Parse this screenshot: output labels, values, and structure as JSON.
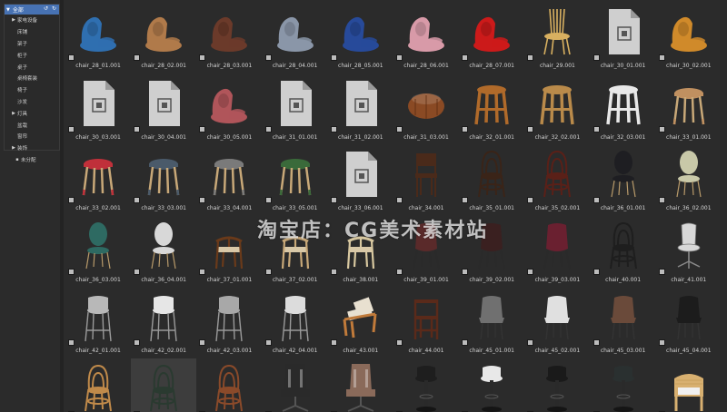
{
  "sidebar": {
    "root_label": "全部",
    "root_controls": "↺ ↻",
    "items": [
      {
        "label": "家电设备",
        "level": 1,
        "expandable": true
      },
      {
        "label": "床铺",
        "level": 1,
        "expandable": false
      },
      {
        "label": "架子",
        "level": 1,
        "expandable": false
      },
      {
        "label": "柜子",
        "level": 1,
        "expandable": false
      },
      {
        "label": "桌子",
        "level": 1,
        "expandable": false
      },
      {
        "label": "桌椅套装",
        "level": 1,
        "expandable": false
      },
      {
        "label": "椅子",
        "level": 1,
        "expandable": false
      },
      {
        "label": "沙发",
        "level": 1,
        "expandable": false
      },
      {
        "label": "灯具",
        "level": 1,
        "expandable": true
      },
      {
        "label": "盆栽",
        "level": 1,
        "expandable": false
      },
      {
        "label": "窗帘",
        "level": 1,
        "expandable": false
      },
      {
        "label": "装饰",
        "level": 1,
        "expandable": true
      },
      {
        "label": "未分配",
        "level": 0,
        "expandable": false
      }
    ]
  },
  "watermark": "淘宝店：CG美术素材站",
  "assets": [
    {
      "label": "chair_28_01.001",
      "kind": "lounge",
      "color": "#2f6fb0"
    },
    {
      "label": "chair_28_02.001",
      "kind": "lounge",
      "color": "#b07a4a"
    },
    {
      "label": "chair_28_03.001",
      "kind": "lounge",
      "color": "#6b3a2a"
    },
    {
      "label": "chair_28_04.001",
      "kind": "lounge",
      "color": "#8a96a8"
    },
    {
      "label": "chair_28_05.001",
      "kind": "lounge",
      "color": "#274a9a"
    },
    {
      "label": "chair_28_06.001",
      "kind": "lounge",
      "color": "#d89aa8"
    },
    {
      "label": "chair_28_07.001",
      "kind": "lounge",
      "color": "#cc1a1a"
    },
    {
      "label": "chair_29.001",
      "kind": "spindle",
      "color": "#d8b060"
    },
    {
      "label": "chair_30_01.001",
      "kind": "file",
      "color": "#cfcfcf"
    },
    {
      "label": "chair_30_02.001",
      "kind": "lounge",
      "color": "#d08a2a"
    },
    {
      "label": "chair_30_03.001",
      "kind": "file",
      "color": "#cfcfcf"
    },
    {
      "label": "chair_30_04.001",
      "kind": "file",
      "color": "#cfcfcf"
    },
    {
      "label": "chair_30_05.001",
      "kind": "lounge",
      "color": "#b0555a"
    },
    {
      "label": "chair_31_01.001",
      "kind": "file",
      "color": "#cfcfcf"
    },
    {
      "label": "chair_31_02.001",
      "kind": "file",
      "color": "#cfcfcf"
    },
    {
      "label": "chair_31_03.001",
      "kind": "pouf",
      "color": "#8a4a24"
    },
    {
      "label": "chair_32_01.001",
      "kind": "woodstool",
      "color": "#b06a2a"
    },
    {
      "label": "chair_32_02.001",
      "kind": "woodstool",
      "color": "#b98a4a"
    },
    {
      "label": "chair_32_03.001",
      "kind": "woodstool",
      "color": "#e8e8e8"
    },
    {
      "label": "chair_33_01.001",
      "kind": "stool",
      "color": "#c09060"
    },
    {
      "label": "chair_33_02.001",
      "kind": "stool",
      "color": "#c0303a"
    },
    {
      "label": "chair_33_03.001",
      "kind": "stool",
      "color": "#4a5a6a"
    },
    {
      "label": "chair_33_04.001",
      "kind": "stool",
      "color": "#7a7a7a"
    },
    {
      "label": "chair_33_05.001",
      "kind": "stool",
      "color": "#3a6a3a"
    },
    {
      "label": "chair_33_06.001",
      "kind": "file",
      "color": "#cfcfcf"
    },
    {
      "label": "chair_34.001",
      "kind": "dining",
      "color": "#4a2a1a"
    },
    {
      "label": "chair_35_01.001",
      "kind": "bentwood",
      "color": "#3a2418"
    },
    {
      "label": "chair_35_02.001",
      "kind": "bentwood",
      "color": "#5a2018"
    },
    {
      "label": "chair_36_01.001",
      "kind": "oval",
      "color": "#1e1e22"
    },
    {
      "label": "chair_36_02.001",
      "kind": "oval",
      "color": "#c8c8a8"
    },
    {
      "label": "chair_36_03.001",
      "kind": "oval",
      "color": "#2e6a62"
    },
    {
      "label": "chair_36_04.001",
      "kind": "oval",
      "color": "#d8d8d8"
    },
    {
      "label": "chair_37_01.001",
      "kind": "wishbone",
      "color": "#6a3a1a"
    },
    {
      "label": "chair_37_02.001",
      "kind": "wishbone",
      "color": "#c8a878"
    },
    {
      "label": "chair_38.001",
      "kind": "wishbone",
      "color": "#d8c8a0"
    },
    {
      "label": "chair_39_01.001",
      "kind": "shell",
      "color": "#5a2a2a"
    },
    {
      "label": "chair_39_02.001",
      "kind": "shell",
      "color": "#3a2020"
    },
    {
      "label": "chair_39_03.001",
      "kind": "shell",
      "color": "#6a2030"
    },
    {
      "label": "chair_40.001",
      "kind": "bentwood",
      "color": "#1e1e1e"
    },
    {
      "label": "chair_41.001",
      "kind": "office",
      "color": "#d8d8d8"
    },
    {
      "label": "chair_42_01.001",
      "kind": "barstool",
      "color": "#b8b8b8"
    },
    {
      "label": "chair_42_02.001",
      "kind": "barstool",
      "color": "#e6e6e6"
    },
    {
      "label": "chair_42_03.001",
      "kind": "barstool",
      "color": "#a8a8a8"
    },
    {
      "label": "chair_42_04.001",
      "kind": "barstool",
      "color": "#dcdcdc"
    },
    {
      "label": "chair_43.001",
      "kind": "armchair",
      "color": "#c07a3a"
    },
    {
      "label": "chair_44.001",
      "kind": "tallchair",
      "color": "#5a2a1a"
    },
    {
      "label": "chair_45_01.001",
      "kind": "modern",
      "color": "#707070"
    },
    {
      "label": "chair_45_02.001",
      "kind": "modern",
      "color": "#e0e0e0"
    },
    {
      "label": "chair_45_03.001",
      "kind": "modern",
      "color": "#6a4a3a"
    },
    {
      "label": "chair_45_04.001",
      "kind": "modern",
      "color": "#1c1c1c"
    },
    {
      "label": "",
      "kind": "bentwood",
      "color": "#c08a4a"
    },
    {
      "label": "",
      "kind": "bentwood",
      "color": "#2a3a30",
      "selected": true
    },
    {
      "label": "",
      "kind": "bentwood",
      "color": "#8a4a2a"
    },
    {
      "label": "",
      "kind": "gaming",
      "color": "#2a2a2a"
    },
    {
      "label": "",
      "kind": "gaming",
      "color": "#8a6a5a"
    },
    {
      "label": "",
      "kind": "pedestal",
      "color": "#1e1e1e"
    },
    {
      "label": "",
      "kind": "pedestal",
      "color": "#e8e8e8"
    },
    {
      "label": "",
      "kind": "pedestal",
      "color": "#1a1a1a"
    },
    {
      "label": "",
      "kind": "pedestal",
      "color": "#2a3030"
    },
    {
      "label": "",
      "kind": "wicker",
      "color": "#d8b070"
    }
  ]
}
